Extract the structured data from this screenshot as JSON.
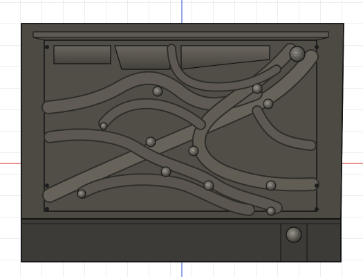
{
  "app": {
    "view": "3D viewport",
    "background_color": "#ffffff",
    "grid_color": "#d7dbe0",
    "axis_blue": "#4e6fd8",
    "axis_red": "#e05252"
  },
  "model": {
    "description_icon": "cad-part-icon",
    "body_color": "#4d4a43",
    "body_dark": "#3c3a35",
    "body_light": "#6b675f",
    "edge_color": "#111111"
  }
}
